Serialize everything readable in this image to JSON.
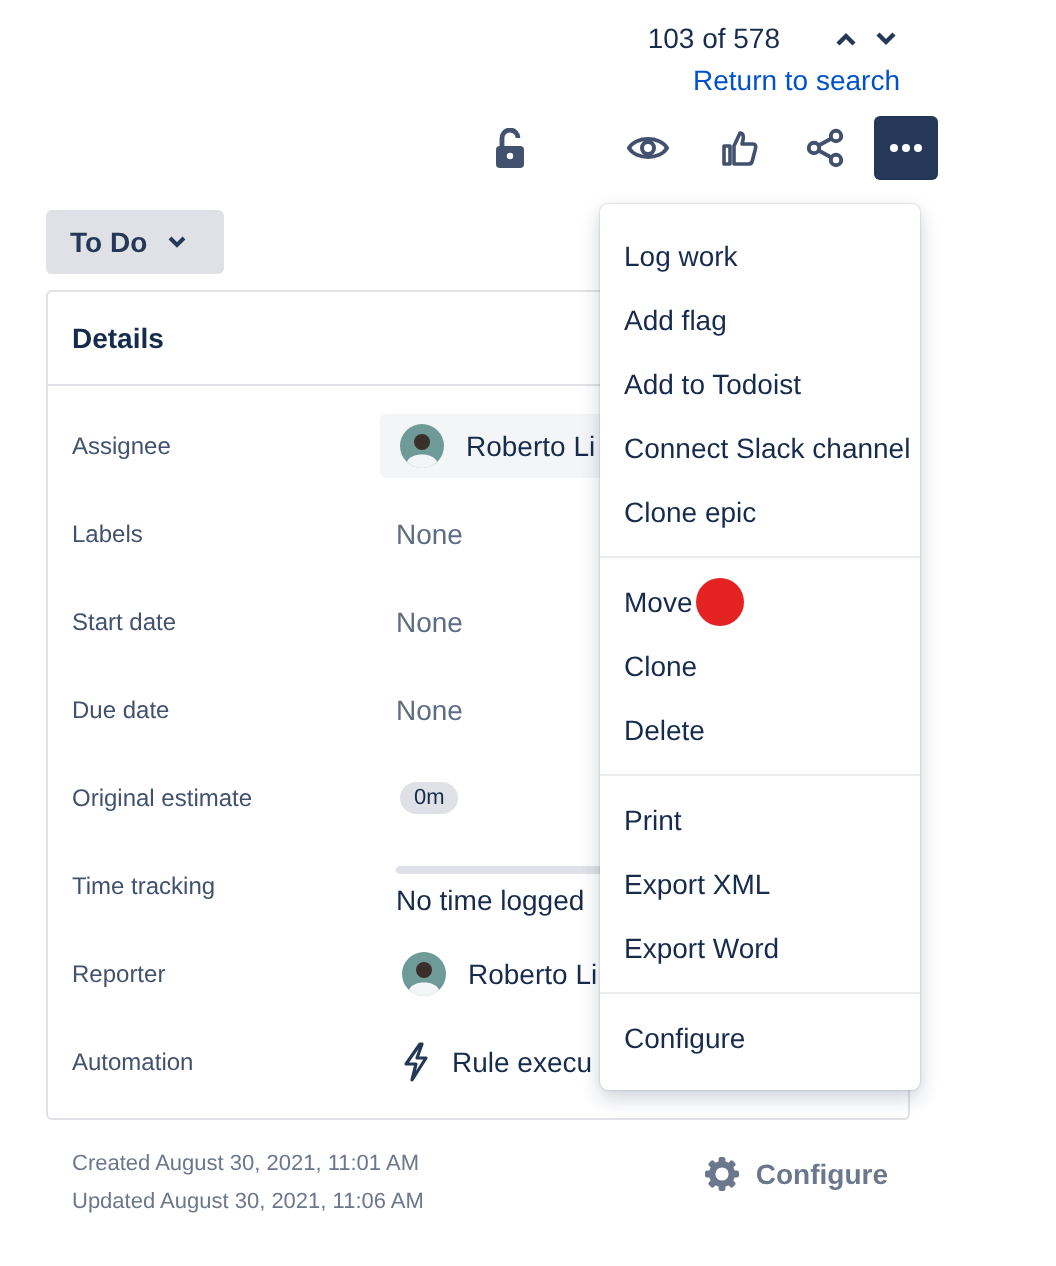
{
  "pager": {
    "position": "103 of 578",
    "link": "Return to search"
  },
  "status": {
    "label": "To Do"
  },
  "details": {
    "title": "Details",
    "fields": [
      {
        "label": "Assignee",
        "kind": "user",
        "value": "Roberto Li"
      },
      {
        "label": "Labels",
        "kind": "text",
        "value": "None"
      },
      {
        "label": "Start date",
        "kind": "text",
        "value": "None"
      },
      {
        "label": "Due date",
        "kind": "text",
        "value": "None"
      },
      {
        "label": "Original estimate",
        "kind": "tag",
        "value": "0m"
      },
      {
        "label": "Time tracking",
        "kind": "tracking",
        "value": "No time logged",
        "level": 0
      },
      {
        "label": "Reporter",
        "kind": "person",
        "value": "Roberto Li"
      },
      {
        "label": "Automation",
        "kind": "automation",
        "value": "Rule execu"
      }
    ]
  },
  "menu": {
    "groups": [
      {
        "items": [
          {
            "label": "Log work"
          },
          {
            "label": "Add flag"
          },
          {
            "label": "Add to Todoist"
          },
          {
            "label": "Connect Slack channel"
          },
          {
            "label": "Clone epic"
          }
        ]
      },
      {
        "items": [
          {
            "label": "Move",
            "marked": true
          },
          {
            "label": "Clone"
          },
          {
            "label": "Delete"
          }
        ]
      },
      {
        "items": [
          {
            "label": "Print"
          },
          {
            "label": "Export XML"
          },
          {
            "label": "Export Word"
          }
        ]
      },
      {
        "items": [
          {
            "label": "Configure"
          }
        ]
      }
    ]
  },
  "footer": {
    "created": "Created August 30, 2021, 11:01 AM",
    "updated": "Updated August 30, 2021, 11:06 AM",
    "configure": "Configure"
  }
}
